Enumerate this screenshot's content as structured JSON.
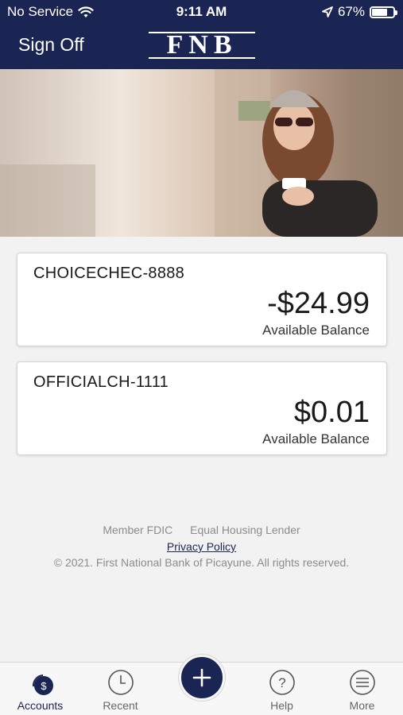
{
  "status_bar": {
    "carrier": "No Service",
    "time": "9:11 AM",
    "battery": "67%",
    "battery_level": 0.67
  },
  "header": {
    "sign_off": "Sign Off",
    "logo": "FNB"
  },
  "accounts": [
    {
      "name": "CHOICECHEC-8888",
      "amount": "-$24.99",
      "balance_label": "Available Balance"
    },
    {
      "name": "OFFICIALCH-1111",
      "amount": "$0.01",
      "balance_label": "Available Balance"
    }
  ],
  "footer": {
    "member": "Member FDIC",
    "housing": "Equal Housing Lender",
    "privacy": "Privacy Policy",
    "copyright": "© 2021. First National Bank of Picayune. All rights reserved."
  },
  "tabs": [
    {
      "label": "Accounts",
      "icon": "dollar-icon"
    },
    {
      "label": "Recent",
      "icon": "clock-icon"
    },
    {
      "label": "",
      "icon": "plus-icon"
    },
    {
      "label": "Help",
      "icon": "question-icon"
    },
    {
      "label": "More",
      "icon": "menu-icon"
    }
  ],
  "colors": {
    "brand_navy": "#1b2554",
    "background": "#f2f2f2"
  }
}
